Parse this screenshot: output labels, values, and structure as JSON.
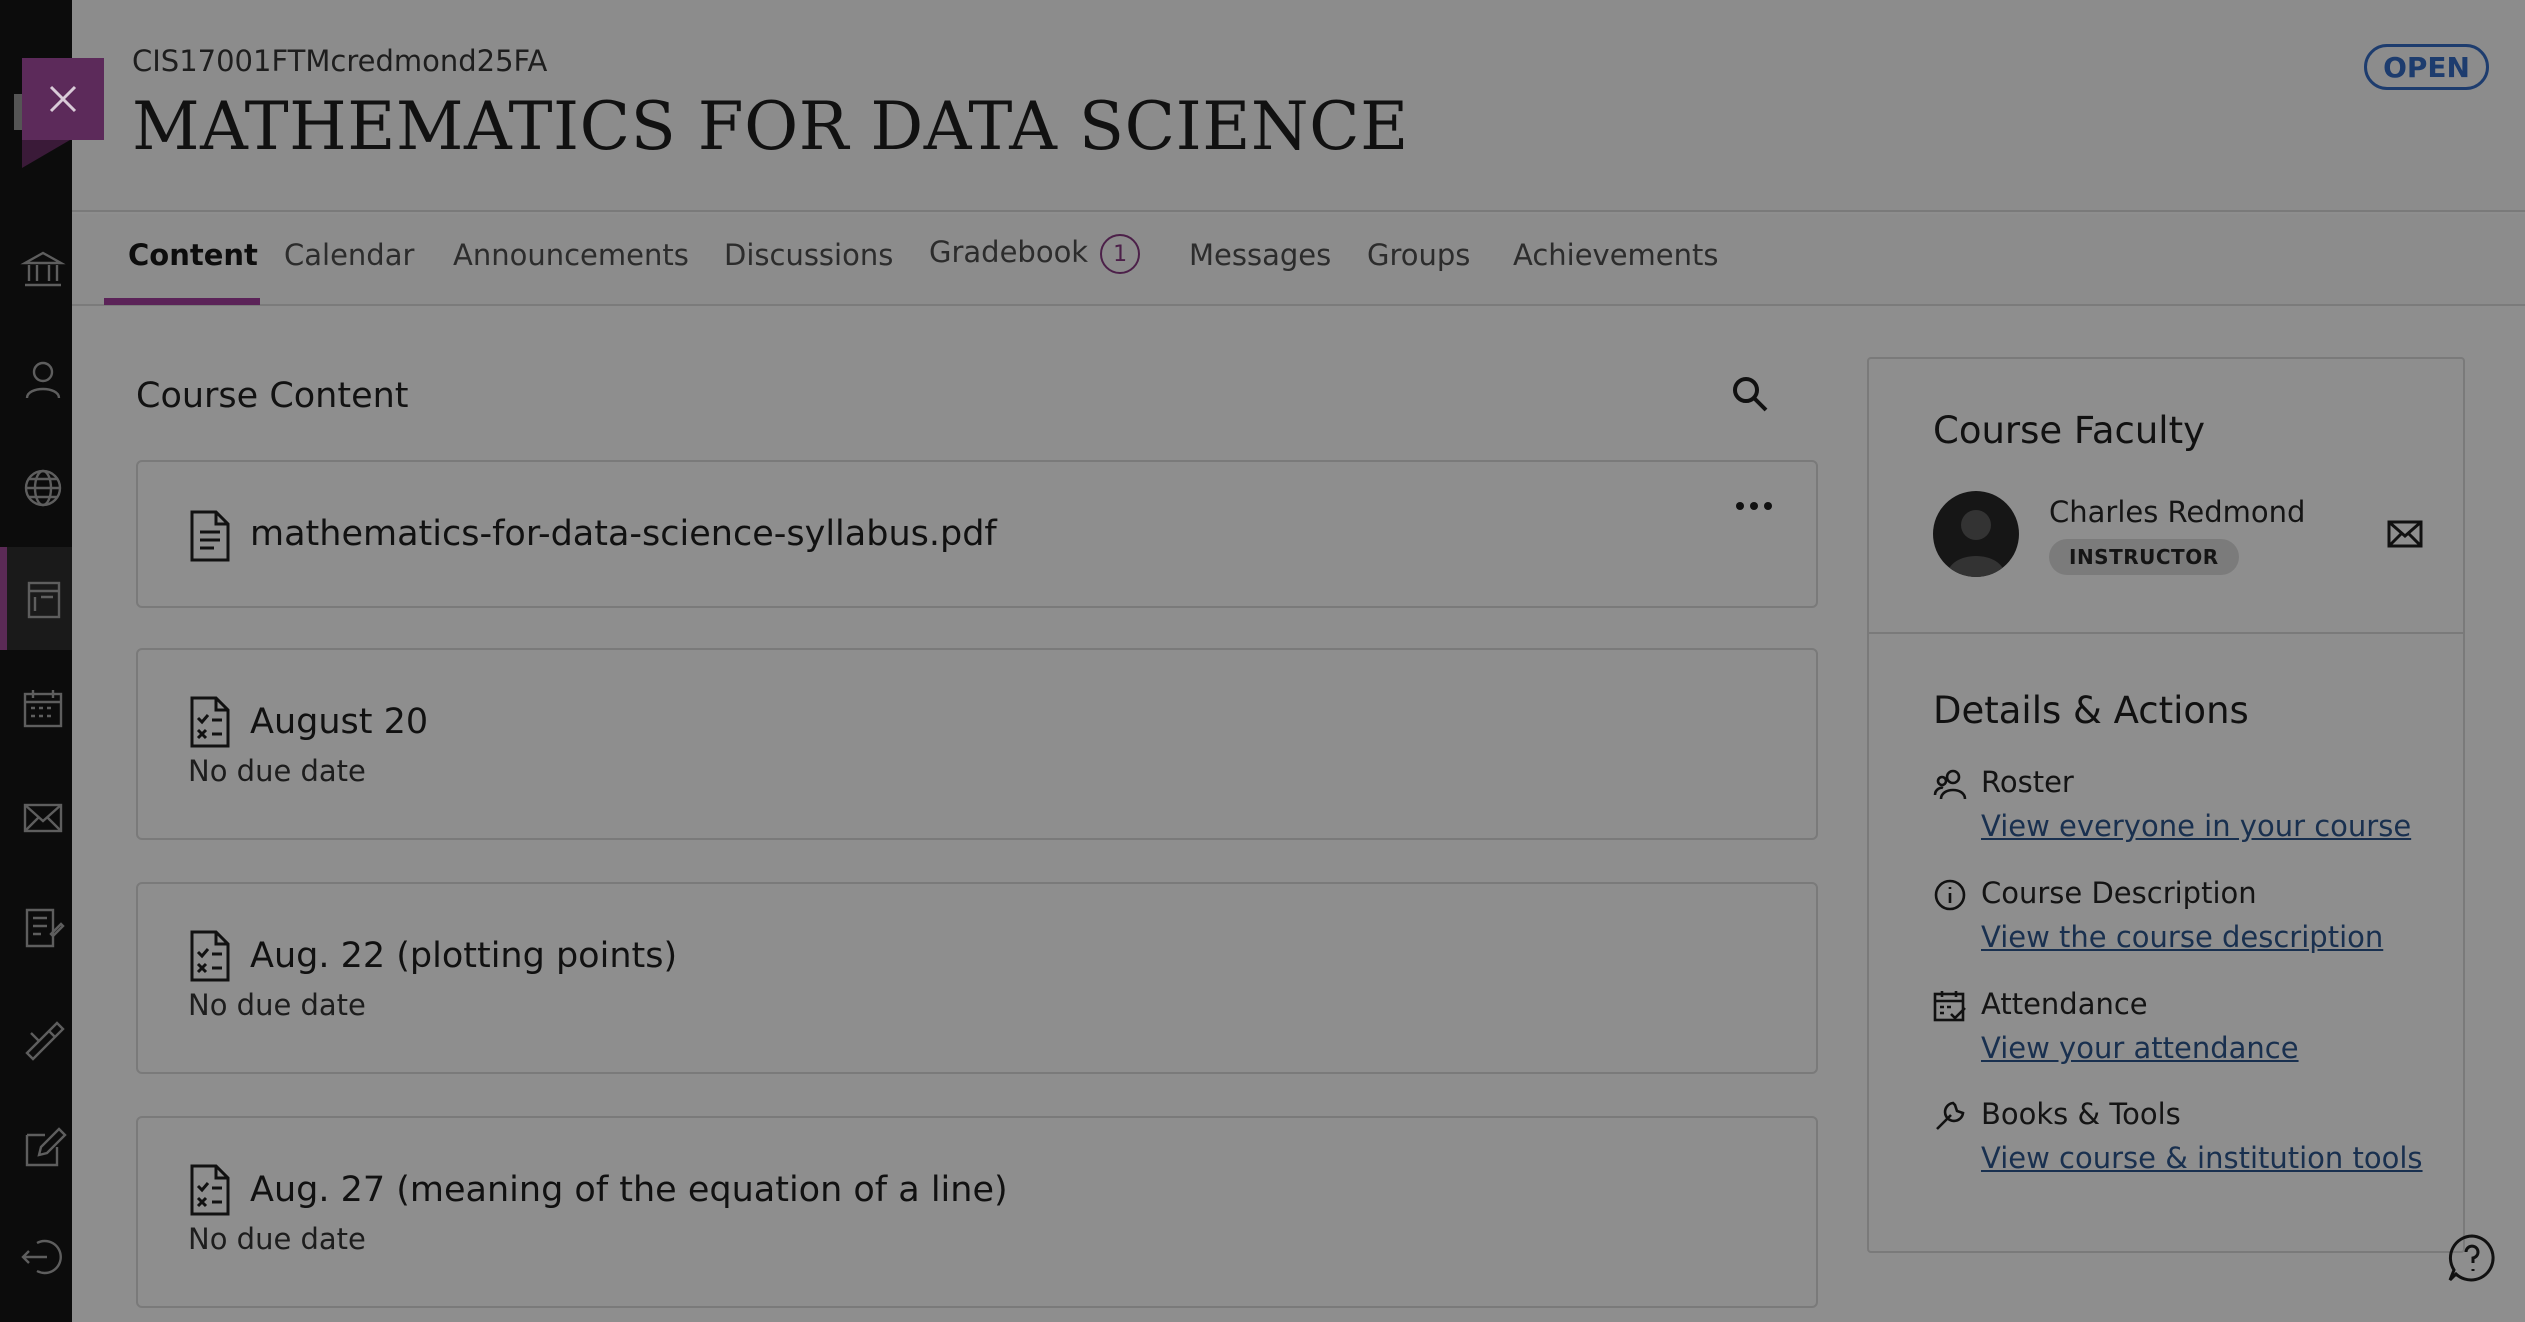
{
  "course": {
    "code": "CIS17001FTMcredmond25FA",
    "title": "MATHEMATICS FOR DATA SCIENCE",
    "status": "OPEN"
  },
  "tabs": [
    {
      "label": "Content",
      "active": true
    },
    {
      "label": "Calendar"
    },
    {
      "label": "Announcements"
    },
    {
      "label": "Discussions"
    },
    {
      "label": "Gradebook",
      "badge": "1"
    },
    {
      "label": "Messages"
    },
    {
      "label": "Groups"
    },
    {
      "label": "Achievements"
    }
  ],
  "content": {
    "heading": "Course Content",
    "items": [
      {
        "title": "mathematics-for-data-science-syllabus.pdf",
        "icon": "document-icon"
      },
      {
        "title": "August 20",
        "subtitle": "No due date",
        "icon": "assignment-icon"
      },
      {
        "title": "Aug. 22 (plotting points)",
        "subtitle": "No due date",
        "icon": "assignment-icon"
      },
      {
        "title": "Aug. 27 (meaning of the equation of a line)",
        "subtitle": "No due date",
        "icon": "assignment-icon"
      }
    ]
  },
  "faculty": {
    "heading": "Course Faculty",
    "name": "Charles Redmond",
    "role": "INSTRUCTOR"
  },
  "details": {
    "heading": "Details & Actions",
    "actions": [
      {
        "label": "Roster",
        "link": "View everyone in your course",
        "icon": "roster-icon"
      },
      {
        "label": "Course Description",
        "link": "View the course description",
        "icon": "info-icon"
      },
      {
        "label": "Attendance",
        "link": "View your attendance",
        "icon": "attendance-icon"
      },
      {
        "label": "Books & Tools",
        "link": "View course & institution tools",
        "icon": "wrench-icon"
      }
    ]
  },
  "colors": {
    "overlay": "#8c8c8c",
    "rail": "#0c0c0c",
    "accent": "#5b2358",
    "link": "#19304f"
  }
}
